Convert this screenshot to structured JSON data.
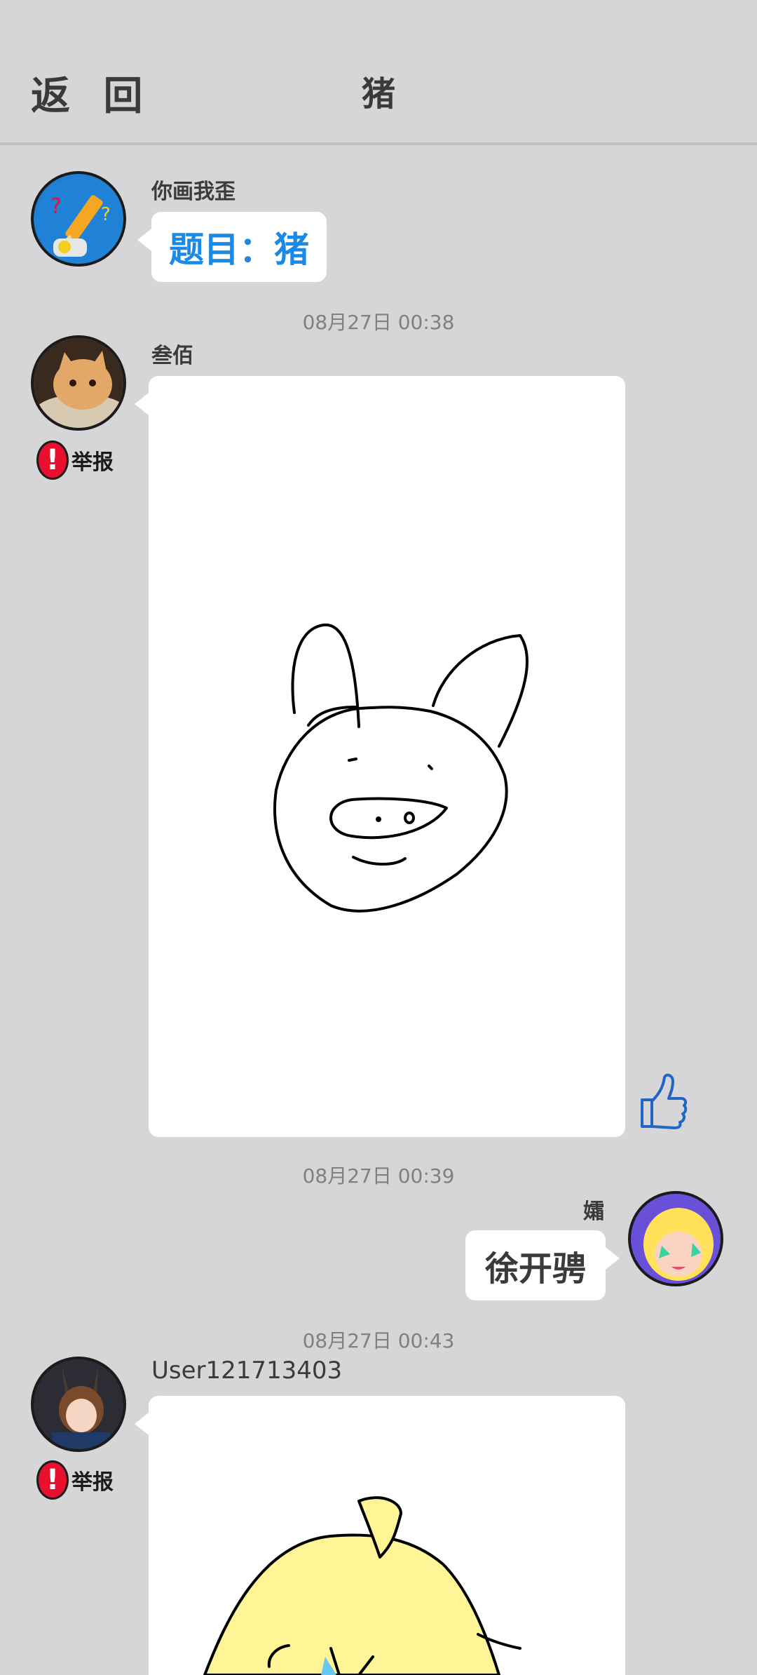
{
  "header": {
    "back_label": "返 回",
    "title": "猪"
  },
  "messages": [
    {
      "sender": "你画我歪",
      "text": "题目：猪",
      "text_color": "#1a8ae6"
    },
    {
      "timestamp": "08月27日  00:38",
      "sender": "叁佰",
      "report_label": "举报"
    },
    {
      "timestamp": "08月27日  00:39",
      "sender": "孀",
      "text": "徐开骋",
      "text_color": "#3a3a3a"
    },
    {
      "timestamp": "08月27日  00:43",
      "sender": "User121713403",
      "report_label": "举报"
    }
  ],
  "colors": {
    "background": "#d6d6d8",
    "report_red": "#e8102e",
    "accent_blue": "#1a8ae6",
    "sketch_yellow": "#fff596"
  },
  "icons": [
    "pencil-avatar-icon",
    "report-icon",
    "thumbs-up-icon"
  ]
}
